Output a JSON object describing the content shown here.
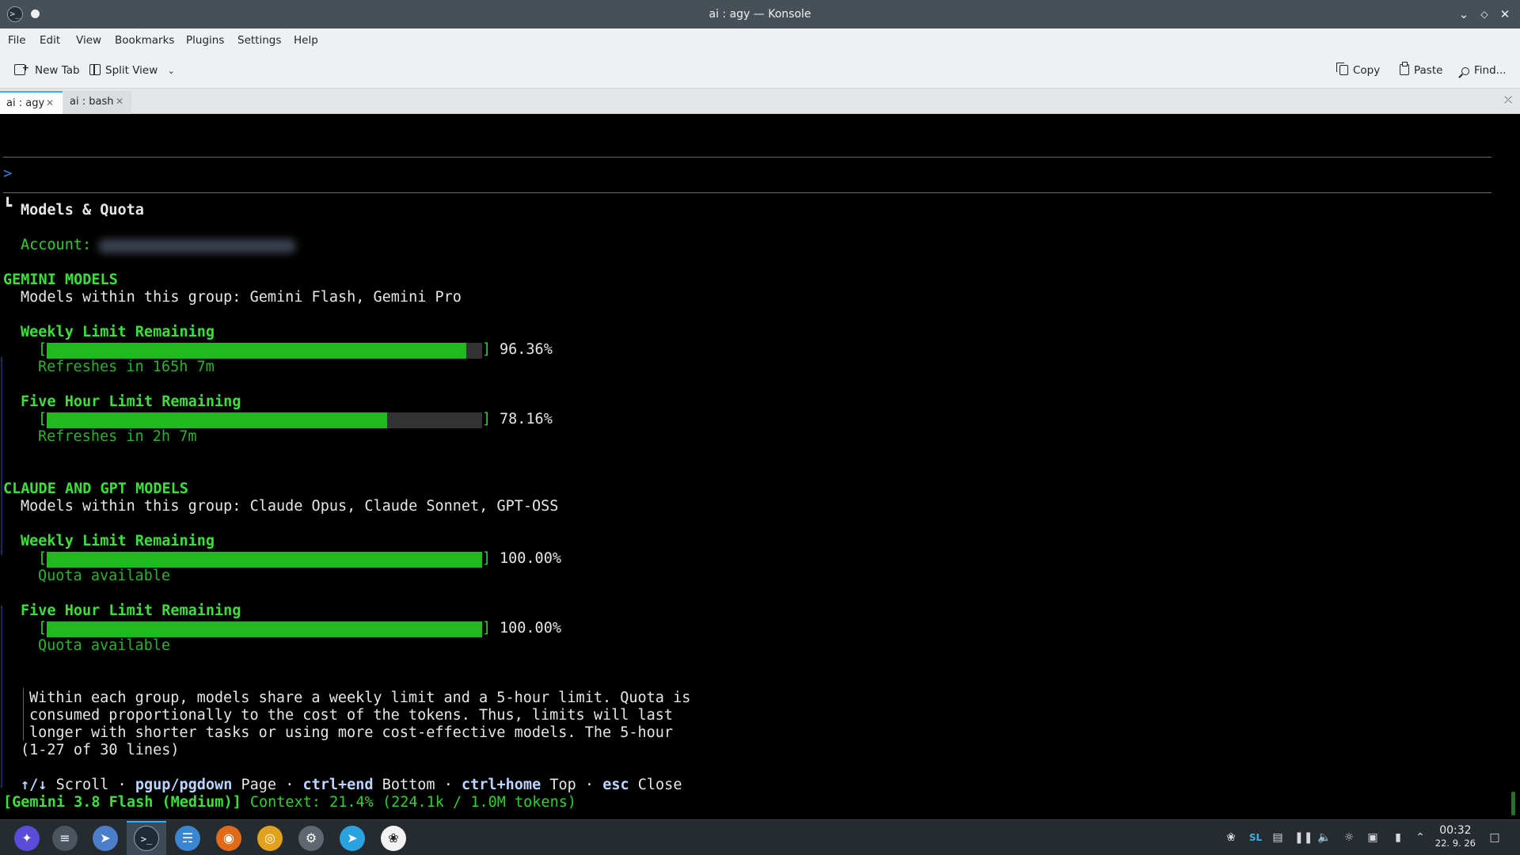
{
  "window": {
    "title": "ai : agy — Konsole"
  },
  "menubar": [
    "File",
    "Edit",
    "View",
    "Bookmarks",
    "Plugins",
    "Settings",
    "Help"
  ],
  "toolbar": {
    "new_tab": "New Tab",
    "split_view": "Split View",
    "copy": "Copy",
    "paste": "Paste",
    "find": "Find..."
  },
  "tabs": [
    {
      "label": "ai : agy",
      "active": true
    },
    {
      "label": "ai : bash",
      "active": false
    }
  ],
  "terminal": {
    "prompt": ">",
    "panel_marker": "┗",
    "panel_title": "Models & Quota",
    "account_label": "Account:",
    "groups": [
      {
        "title": "GEMINI MODELS",
        "members": "Models within this group: Gemini Flash, Gemini Pro",
        "limits": [
          {
            "label": "Weekly Limit Remaining",
            "percent_text": "96.36%",
            "fraction": 0.9636,
            "status": "Refreshes in 165h 7m"
          },
          {
            "label": "Five Hour Limit Remaining",
            "percent_text": "78.16%",
            "fraction": 0.7816,
            "status": "Refreshes in 2h 7m"
          }
        ]
      },
      {
        "title": "CLAUDE AND GPT MODELS",
        "members": "Models within this group: Claude Opus, Claude Sonnet, GPT-OSS",
        "limits": [
          {
            "label": "Weekly Limit Remaining",
            "percent_text": "100.00%",
            "fraction": 1.0,
            "status": "Quota available"
          },
          {
            "label": "Five Hour Limit Remaining",
            "percent_text": "100.00%",
            "fraction": 1.0,
            "status": "Quota available"
          }
        ]
      }
    ],
    "note_lines": [
      "Within each group, models share a weekly limit and a 5-hour limit. Quota is",
      "consumed proportionally to the cost of the tokens. Thus, limits will last",
      "longer with shorter tasks or using more cost-effective models. The 5-hour"
    ],
    "line_counter": "(1-27 of 30 lines)",
    "keys": [
      {
        "key": "↑/↓",
        "action": "Scroll"
      },
      {
        "key": "pgup/pgdown",
        "action": "Page"
      },
      {
        "key": "ctrl+end",
        "action": "Bottom"
      },
      {
        "key": "ctrl+home",
        "action": "Top"
      },
      {
        "key": "esc",
        "action": "Close"
      }
    ],
    "key_separator": "·",
    "status_model": "[Gemini 3.8 Flash (Medium)]",
    "status_context": "Context: 21.4% (224.1k / 1.0M tokens)"
  },
  "taskbar": {
    "apps": [
      "app-launcher",
      "system-settings",
      "discover",
      "konsole",
      "dolphin",
      "firefox",
      "chrome",
      "gimp",
      "telegram",
      "chatgpt"
    ],
    "tray_sl": "SL",
    "clock_time": "00:32",
    "clock_date": "22. 9. 26"
  },
  "colors": {
    "accent": "#3daee9",
    "terminal_green": "#2fd02f",
    "bar_fill": "#22b822",
    "titlebar": "#475057"
  }
}
